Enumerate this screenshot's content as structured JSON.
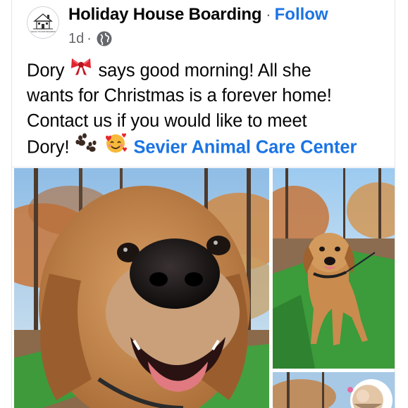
{
  "post": {
    "page_name": "Holiday House Boarding",
    "separator": "·",
    "follow_label": "Follow",
    "timestamp": "1d",
    "meta_separator": "·",
    "audience_icon": "globe-icon",
    "avatar_logo_text": "HOLIDAY HOUSE BOARDING",
    "text": {
      "line1_a": "Dory",
      "line1_b": "says good morning! All she",
      "line2": "wants for Christmas is a forever home!",
      "line3": "Contact us if you would like to meet",
      "line4_a": "Dory!",
      "place_link": "Sevier Animal Care Center"
    },
    "emojis": [
      "ribbon-emoji",
      "paw-prints-emoji",
      "smiling-face-with-hearts-emoji"
    ]
  },
  "photos": [
    {
      "name": "dog-closeup-photo",
      "subject": "dog"
    },
    {
      "name": "dog-standing-photo",
      "subject": "dog"
    },
    {
      "name": "dog-third-photo",
      "subject": "dog"
    }
  ],
  "colors": {
    "link_blue": "#1b74e4",
    "secondary_text": "#65676b",
    "divider": "#e4e6eb"
  }
}
